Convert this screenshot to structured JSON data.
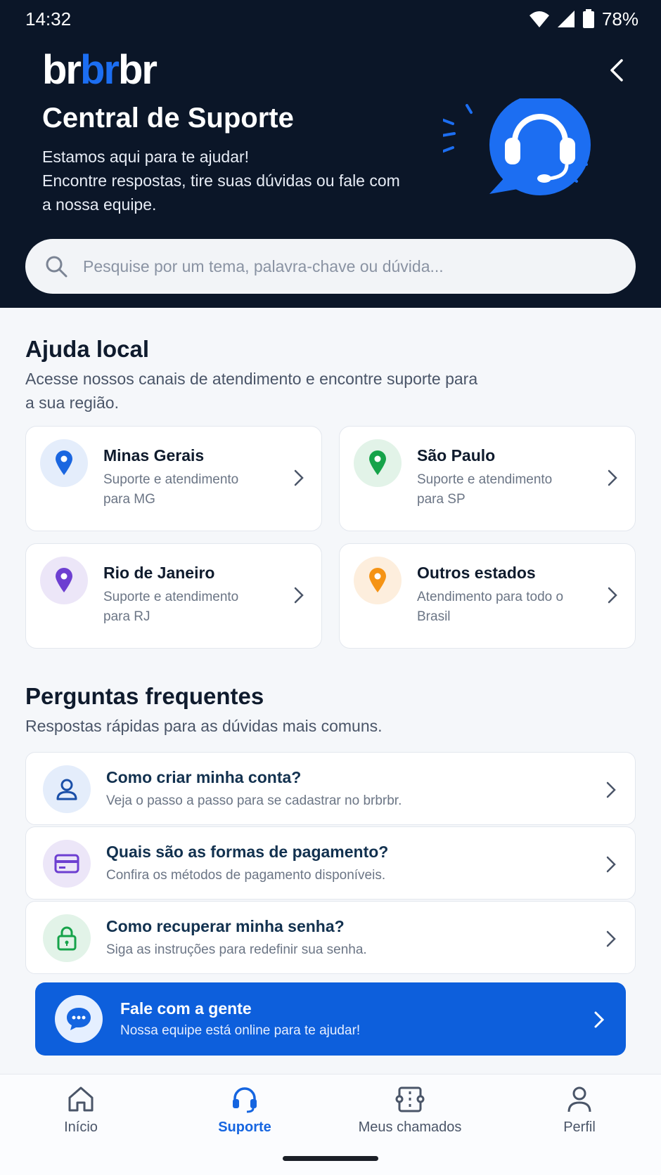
{
  "status_bar": {
    "time": "14:32",
    "battery": "78%"
  },
  "header": {
    "logo": {
      "part1": "br",
      "part2": "br",
      "part3": "br"
    },
    "title": "Central de Suporte",
    "subtitle_line1": "Estamos aqui para te ajudar!",
    "subtitle_line2": "Encontre respostas, tire suas dúvidas ou fale com a nossa equipe."
  },
  "search": {
    "placeholder": "Pesquise por um tema, palavra-chave ou dúvida..."
  },
  "local_help": {
    "title": "Ajuda local",
    "subtitle": "Acesse nossos canais de atendimento e encontre suporte para a sua região.",
    "items": [
      {
        "title": "Minas Gerais",
        "subtitle": "Suporte e atendimento para MG",
        "color": "#1a66e0",
        "bg": "#e4edfb"
      },
      {
        "title": "São Paulo",
        "subtitle": "Suporte e atendimento para SP",
        "color": "#16a34a",
        "bg": "#e2f3e8"
      },
      {
        "title": "Rio de Janeiro",
        "subtitle": "Suporte e atendimento para RJ",
        "color": "#6d3fd1",
        "bg": "#ece6f8"
      },
      {
        "title": "Outros estados",
        "subtitle": "Atendimento para todo o Brasil",
        "color": "#f59314",
        "bg": "#fdeedd"
      }
    ]
  },
  "faq": {
    "title": "Perguntas frequentes",
    "subtitle": "Respostas rápidas para as dúvidas mais comuns.",
    "items": [
      {
        "title": "Como criar minha conta?",
        "subtitle": "Veja o passo a passo para se cadastrar no brbrbr.",
        "icon": "user-icon"
      },
      {
        "title": "Quais são as formas de pagamento?",
        "subtitle": "Confira os métodos de pagamento disponíveis.",
        "icon": "credit-card-icon"
      },
      {
        "title": "Como recuperar minha senha?",
        "subtitle": "Siga as instruções para redefinir sua senha.",
        "icon": "lock-icon"
      }
    ]
  },
  "cta": {
    "title": "Fale com a gente",
    "subtitle": "Nossa equipe está online para te ajudar!"
  },
  "bottom_nav": [
    {
      "label": "Início",
      "icon": "home-icon"
    },
    {
      "label": "Suporte",
      "icon": "headset-icon",
      "active": true
    },
    {
      "label": "Meus chamados",
      "icon": "ticket-icon"
    },
    {
      "label": "Perfil",
      "icon": "profile-icon"
    }
  ],
  "colors": {
    "header_bg": "#0b1628",
    "accent": "#1565e0",
    "cta_bg": "#0d5fdc"
  }
}
